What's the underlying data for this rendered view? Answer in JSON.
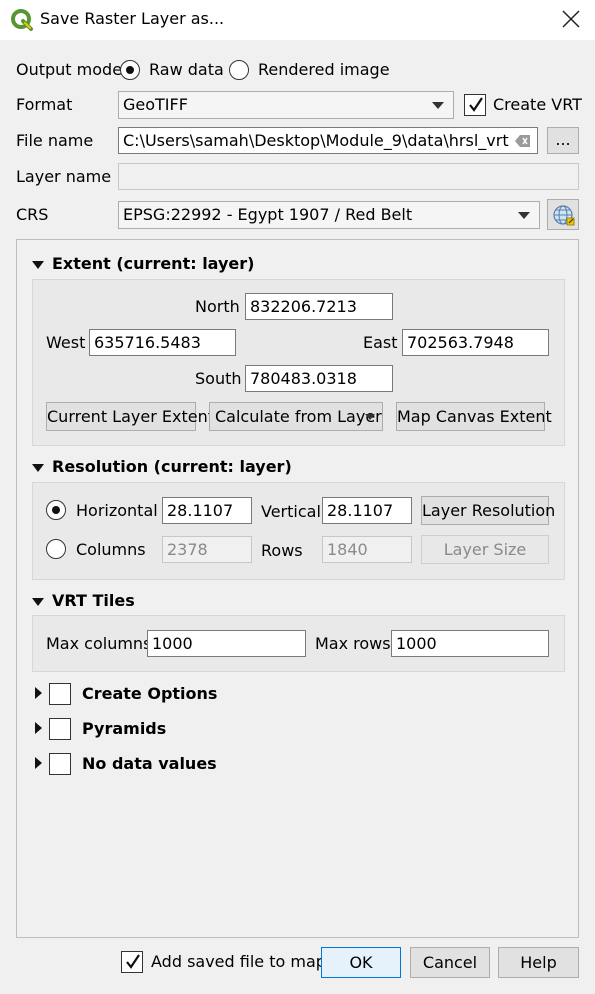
{
  "window": {
    "title": "Save Raster Layer as...",
    "icon": "qgis-logo-icon",
    "close_icon": "close-icon"
  },
  "output_mode": {
    "label": "Output mode",
    "options": [
      "Raw data",
      "Rendered image"
    ],
    "selected": "Raw data"
  },
  "format": {
    "label": "Format",
    "value": "GeoTIFF",
    "create_vrt_label": "Create VRT",
    "create_vrt_checked": true
  },
  "file_name": {
    "label": "File name",
    "value": "C:\\Users\\samah\\Desktop\\Module_9\\data\\hrsl_vrt",
    "browse_label": "..."
  },
  "layer_name": {
    "label": "Layer name",
    "value": ""
  },
  "crs": {
    "label": "CRS",
    "value": "EPSG:22992 - Egypt 1907 / Red Belt",
    "picker_icon": "globe-crs-icon"
  },
  "extent": {
    "title": "Extent (current: layer)",
    "north_label": "North",
    "north": "832206.7213",
    "west_label": "West",
    "west": "635716.5483",
    "east_label": "East",
    "east": "702563.7948",
    "south_label": "South",
    "south": "780483.0318",
    "current_layer_btn": "Current Layer Extent",
    "calculate_btn": "Calculate from Layer",
    "map_canvas_btn": "Map Canvas Extent"
  },
  "resolution": {
    "title": "Resolution (current: layer)",
    "horizontal_label": "Horizontal",
    "horizontal": "28.1107",
    "vertical_label": "Vertical",
    "vertical": "28.1107",
    "layer_resolution_btn": "Layer Resolution",
    "columns_label": "Columns",
    "columns": "2378",
    "rows_label": "Rows",
    "rows": "1840",
    "layer_size_btn": "Layer Size",
    "selected": "Horizontal"
  },
  "vrt_tiles": {
    "title": "VRT Tiles",
    "max_columns_label": "Max columns",
    "max_columns": "1000",
    "max_rows_label": "Max rows",
    "max_rows": "1000"
  },
  "collapsed_groups": [
    "Create Options",
    "Pyramids",
    "No data values"
  ],
  "footer": {
    "add_to_map_label": "Add saved file to map",
    "add_to_map_checked": true,
    "ok": "OK",
    "cancel": "Cancel",
    "help": "Help"
  },
  "colors": {
    "window_bg": "#f0f0f0",
    "titlebar_bg": "#ffffff",
    "default_button_border": "#0078d7",
    "qgis_green": "#589632",
    "qgis_yellow": "#eec900"
  }
}
